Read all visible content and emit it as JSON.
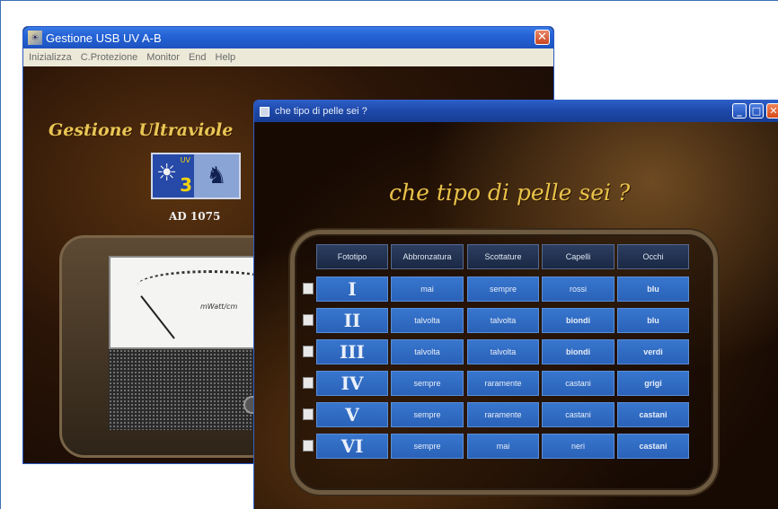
{
  "back_window": {
    "title": "Gestione USB UV A-B",
    "close_glyph": "✕",
    "menu": [
      "Inizializza",
      "C.Protezione",
      "Monitor",
      "End",
      "Help"
    ],
    "heading": "Gestione Ultraviole",
    "uv_index_label": "UV",
    "uv_index": "3",
    "device_label": "AD 1075",
    "meter_units": "mWatt/cm"
  },
  "front_window": {
    "title": "che  tipo  di  pelle  sei ?",
    "minimize_glyph": "_",
    "maximize_glyph": "□",
    "close_glyph": "✕",
    "question": "che tipo di  pelle  sei ?",
    "columns": [
      "Fototipo",
      "Abbronzatura",
      "Scottature",
      "Capelli",
      "Occhi"
    ],
    "rows": [
      {
        "type": "I",
        "abbronzatura": "mai",
        "scottature": "sempre",
        "capelli": "rossi",
        "occhi": "blu"
      },
      {
        "type": "II",
        "abbronzatura": "talvolta",
        "scottature": "talvolta",
        "capelli": "biondi",
        "occhi": "blu"
      },
      {
        "type": "III",
        "abbronzatura": "talvolta",
        "scottature": "talvolta",
        "capelli": "biondi",
        "occhi": "verdi"
      },
      {
        "type": "IV",
        "abbronzatura": "sempre",
        "scottature": "raramente",
        "capelli": "castani",
        "occhi": "grigi"
      },
      {
        "type": "V",
        "abbronzatura": "sempre",
        "scottature": "raramente",
        "capelli": "castani",
        "occhi": "castani"
      },
      {
        "type": "VI",
        "abbronzatura": "sempre",
        "scottature": "mai",
        "capelli": "neri",
        "occhi": "castani"
      }
    ]
  }
}
